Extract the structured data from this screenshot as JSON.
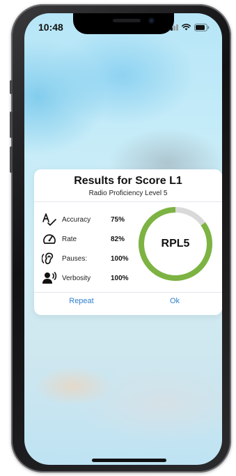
{
  "status_bar": {
    "time": "10:48"
  },
  "dialog": {
    "title": "Results for Score L1",
    "subtitle": "Radio Proficiency Level 5",
    "metrics": [
      {
        "icon": "spell-check-icon",
        "label": "Accuracy",
        "value": "75%"
      },
      {
        "icon": "speedometer-icon",
        "label": "Rate",
        "value": "82%"
      },
      {
        "icon": "ear-icon",
        "label": "Pauses:",
        "value": "100%"
      },
      {
        "icon": "speaking-person-icon",
        "label": "Verbosity",
        "value": "100%"
      }
    ],
    "score": {
      "label": "RPL5",
      "progress": 0.85,
      "ring_color": "#7cb342",
      "track_color": "#d9d9d9"
    },
    "buttons": {
      "repeat": "Repeat",
      "ok": "Ok"
    },
    "accent_color": "#2f7fcf"
  }
}
